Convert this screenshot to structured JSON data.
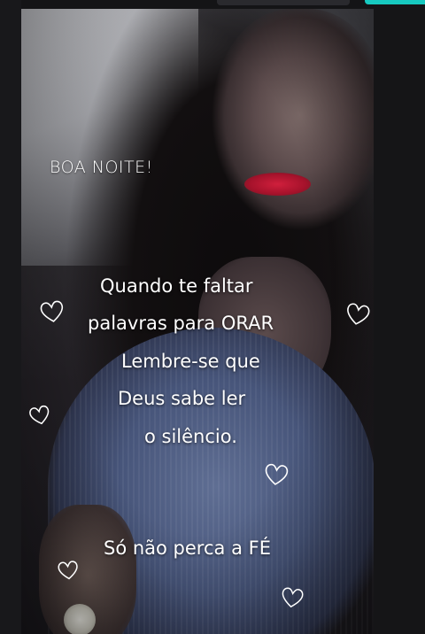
{
  "greeting": "BOA NOITE!",
  "message_lines": [
    "Quando te faltar",
    "palavras para ORAR",
    "Lembre-se que",
    "Deus sabe ler",
    "o silêncio."
  ],
  "closing": "Só não perca a FÉ",
  "colors": {
    "text": "#ffffff",
    "accent_bar": "#17c9c0",
    "lipstick": "#d01f3c",
    "shirt": "#5f6e93"
  },
  "icons": [
    "heart-icon"
  ]
}
